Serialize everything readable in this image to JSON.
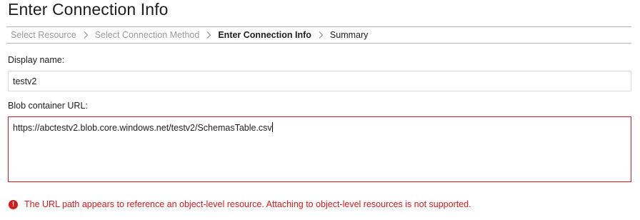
{
  "page": {
    "title": "Enter Connection Info"
  },
  "wizard": {
    "steps": [
      {
        "label": "Select Resource",
        "state": "done"
      },
      {
        "label": "Select Connection Method",
        "state": "done"
      },
      {
        "label": "Enter Connection Info",
        "state": "current"
      },
      {
        "label": "Summary",
        "state": "upcoming"
      }
    ]
  },
  "form": {
    "display_name": {
      "label": "Display name:",
      "value": "testv2"
    },
    "blob_url": {
      "label": "Blob container URL:",
      "value": "https://abctestv2.blob.core.windows.net/testv2/SchemasTable.csv"
    }
  },
  "error": {
    "icon": "exclamation-circle-icon",
    "icon_glyph": "!",
    "message": "The URL path appears to reference an object-level resource. Attaching to object-level resources is not supported.",
    "color": "#d51a1a"
  }
}
